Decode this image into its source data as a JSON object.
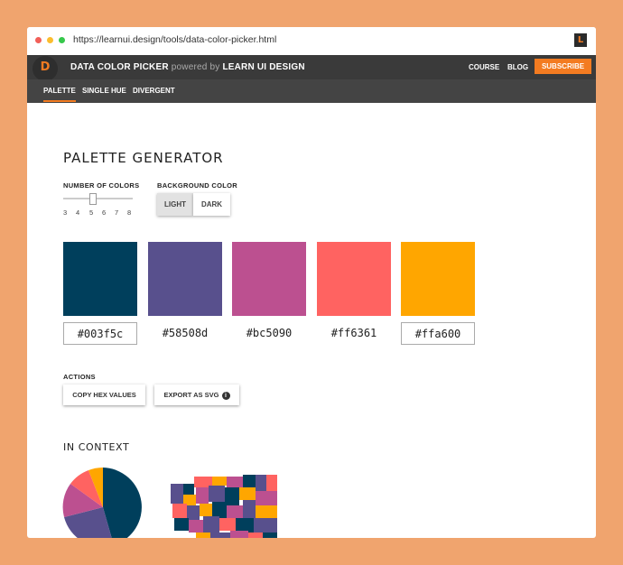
{
  "browser": {
    "url": "https://learnui.design/tools/data-color-picker.html"
  },
  "header": {
    "logo_letter": "D",
    "brand": "DATA COLOR PICKER",
    "powered_by": "powered by",
    "brand_owner": "LEARN UI DESIGN",
    "nav": [
      "COURSE",
      "BLOG"
    ],
    "subscribe": "SUBSCRIBE"
  },
  "tabs": [
    "PALETTE",
    "SINGLE HUE",
    "DIVERGENT"
  ],
  "generator": {
    "title": "PALETTE GENERATOR",
    "num_colors_label": "NUMBER OF COLORS",
    "ticks": [
      "3",
      "4",
      "5",
      "6",
      "7",
      "8"
    ],
    "num_colors_value": 5,
    "background_label": "BACKGROUND COLOR",
    "background_options": [
      "LIGHT",
      "DARK"
    ],
    "background_selected": "LIGHT"
  },
  "palette": [
    {
      "hex": "#003f5c",
      "label": "#003f5c"
    },
    {
      "hex": "#58508d",
      "label": "#58508d"
    },
    {
      "hex": "#bc5090",
      "label": "#bc5090"
    },
    {
      "hex": "#ff6361",
      "label": "#ff6361"
    },
    {
      "hex": "#ffa600",
      "label": "#ffa600"
    }
  ],
  "actions": {
    "label": "ACTIONS",
    "copy": "COPY HEX VALUES",
    "export": "EXPORT AS SVG",
    "info_icon": "i"
  },
  "context": {
    "title": "IN CONTEXT"
  },
  "colors": {
    "accent": "#f37b21",
    "topbar": "#3a3a3a",
    "tabs": "#444444",
    "background": "#f0a46e"
  }
}
